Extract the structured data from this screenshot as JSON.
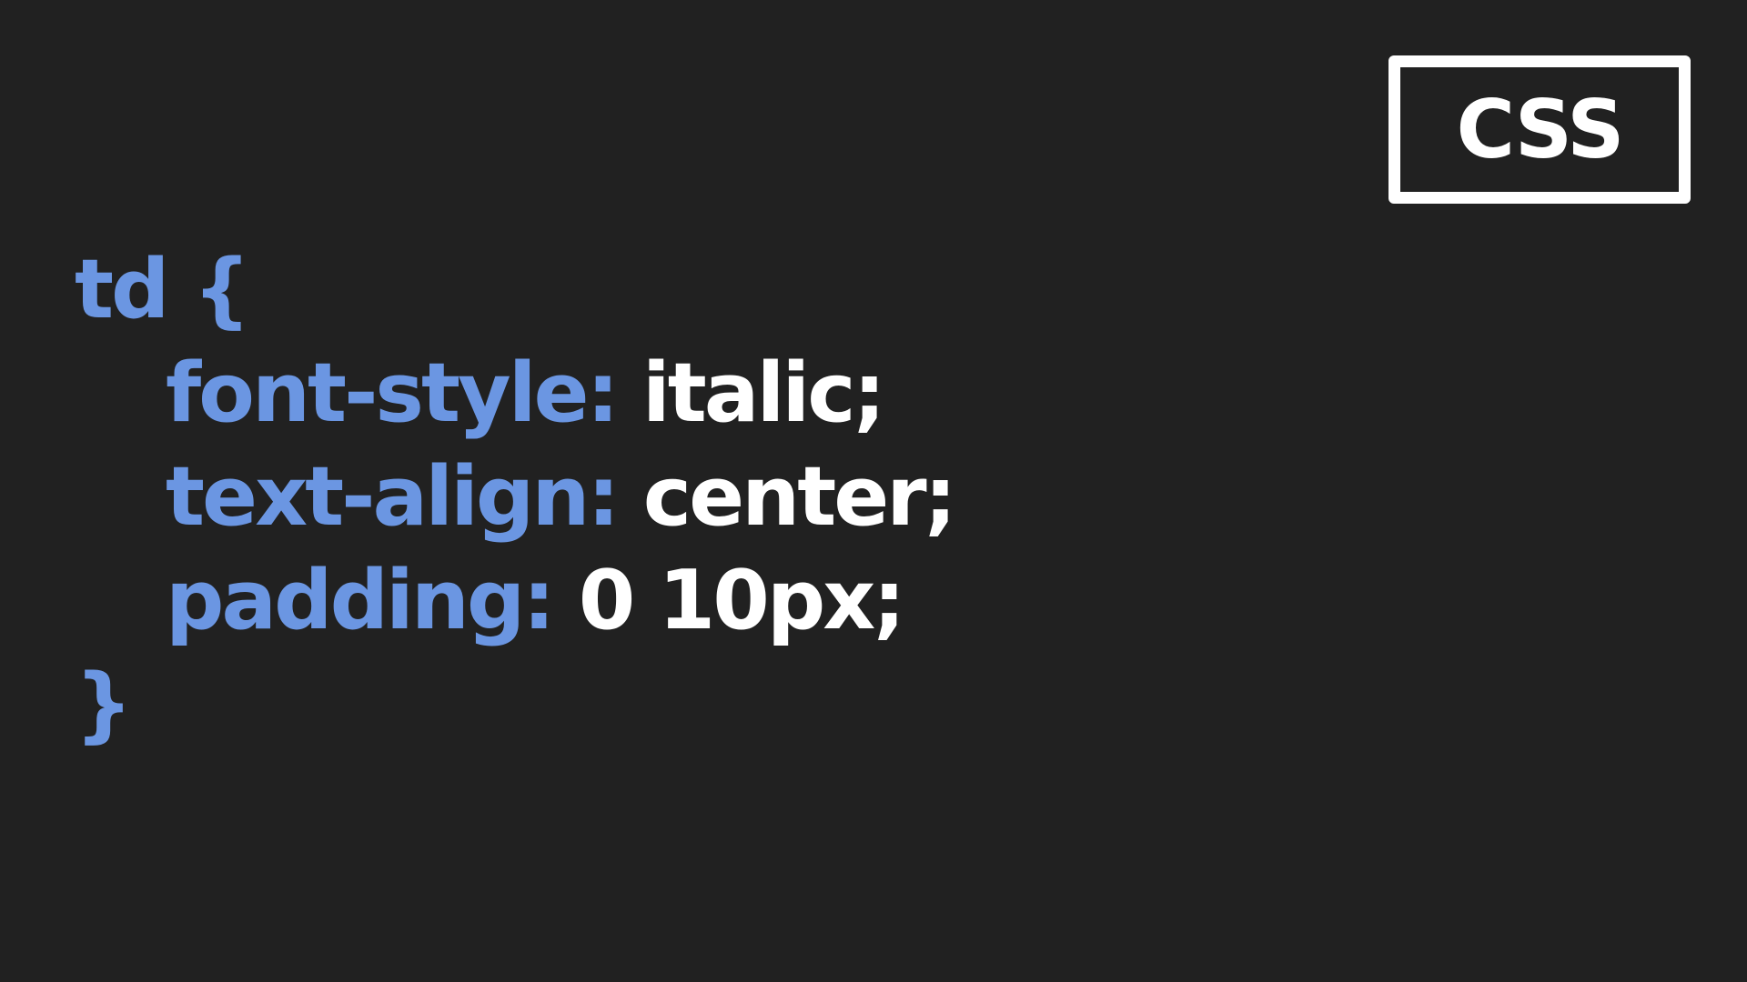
{
  "badge": {
    "label": "CSS"
  },
  "code": {
    "selector": "td",
    "open_brace": "{",
    "close_brace": "}",
    "declarations": [
      {
        "property": "font-style:",
        "value": "italic;"
      },
      {
        "property": "text-align:",
        "value": "center;"
      },
      {
        "property": "padding:",
        "value": "0 10px;"
      }
    ]
  },
  "colors": {
    "background": "#212121",
    "syntax_blue": "#6b96e2",
    "value_white": "#ffffff"
  }
}
